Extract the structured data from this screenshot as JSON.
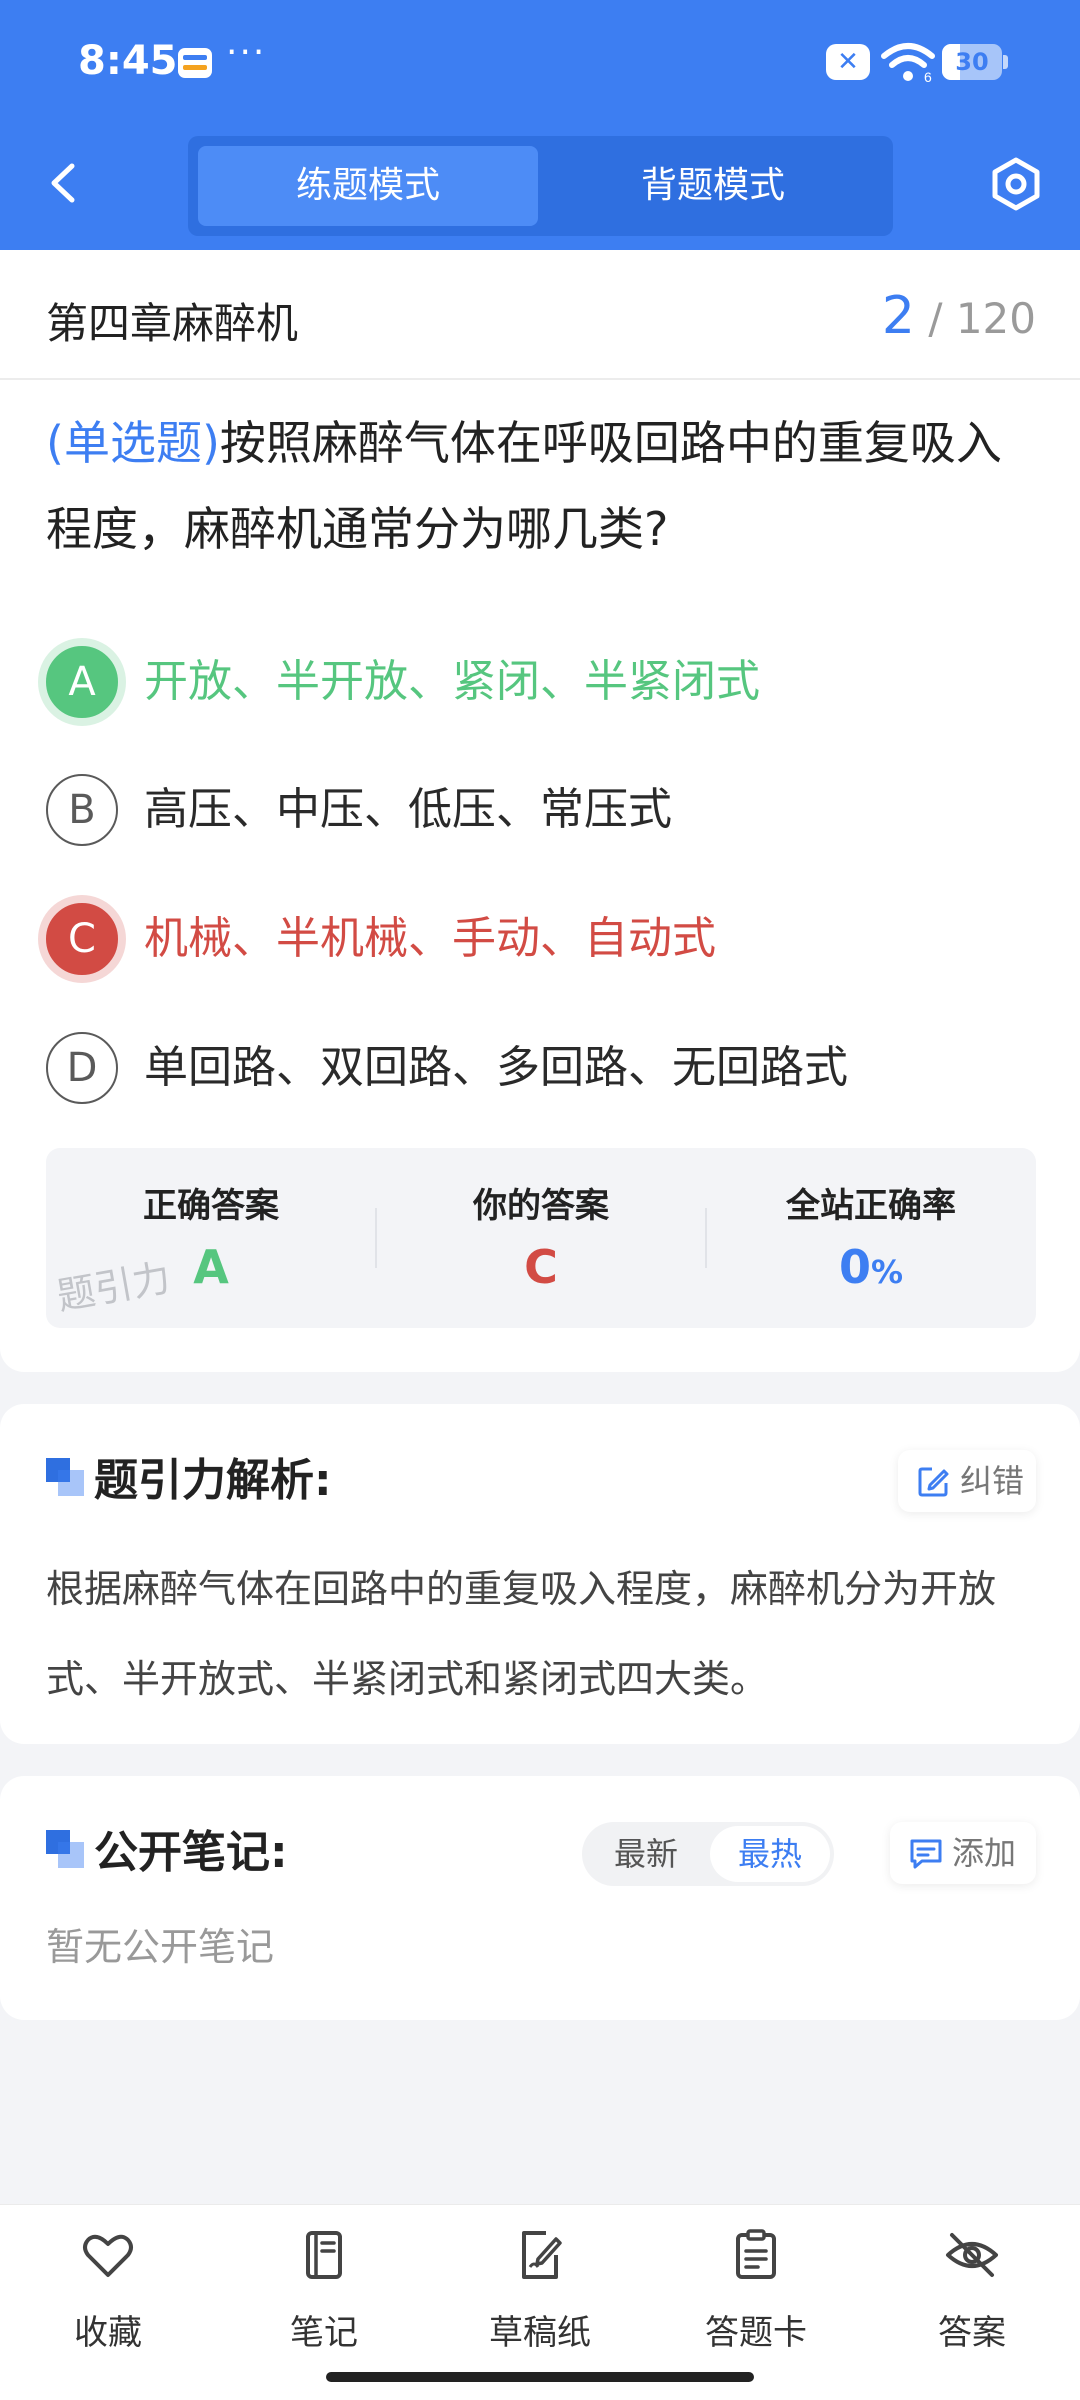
{
  "status_bar": {
    "time": "8:45",
    "dots": "···",
    "battery": "30",
    "close_glyph": "✕"
  },
  "header": {
    "tabs": [
      {
        "label": "练题模式",
        "active": true
      },
      {
        "label": "背题模式",
        "active": false
      }
    ],
    "back_icon": "chevron-left-icon",
    "settings_icon": "hexagon-gear-icon"
  },
  "question": {
    "chapter": "第四章麻醉机",
    "current": "2",
    "total": "/ 120",
    "type": "(单选题)",
    "text": "按照麻醉气体在呼吸回路中的重复吸入程度，麻醉机通常分为哪几类?",
    "options": [
      {
        "letter": "A",
        "text": "开放、半开放、紧闭、半紧闭式",
        "state": "correct"
      },
      {
        "letter": "B",
        "text": "高压、中压、低压、常压式",
        "state": "none"
      },
      {
        "letter": "C",
        "text": "机械、半机械、手动、自动式",
        "state": "wrong"
      },
      {
        "letter": "D",
        "text": "单回路、双回路、多回路、无回路式",
        "state": "none"
      }
    ]
  },
  "answer_summary": {
    "correct_label": "正确答案",
    "correct_value": "A",
    "yours_label": "你的答案",
    "yours_value": "C",
    "rate_label": "全站正确率",
    "rate_value": "0",
    "rate_unit": "%",
    "watermark": "题引力"
  },
  "analysis": {
    "title": "题引力解析:",
    "report_label": "纠错",
    "text": "根据麻醉气体在回路中的重复吸入程度，麻醉机分为开放式、半开放式、半紧闭式和紧闭式四大类。"
  },
  "notes": {
    "title": "公开笔记:",
    "sort_options": [
      {
        "label": "最新",
        "active": false
      },
      {
        "label": "最热",
        "active": true
      }
    ],
    "add_label": "添加",
    "empty_text": "暂无公开笔记"
  },
  "bottom_bar": [
    {
      "label": "收藏",
      "icon": "heart-icon"
    },
    {
      "label": "笔记",
      "icon": "notebook-icon"
    },
    {
      "label": "草稿纸",
      "icon": "draft-paper-icon"
    },
    {
      "label": "答题卡",
      "icon": "answer-card-icon"
    },
    {
      "label": "答案",
      "icon": "eye-off-icon"
    }
  ],
  "colors": {
    "primary": "#3d7ef2",
    "correct": "#56c67f",
    "wrong": "#d24b44"
  }
}
